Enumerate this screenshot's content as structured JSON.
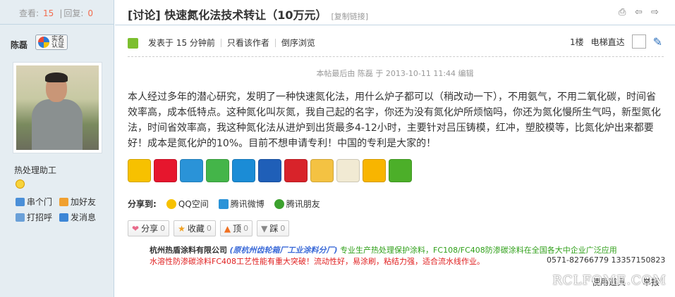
{
  "stats": {
    "views_label": "查看:",
    "views": "15",
    "sep": "|",
    "replies_label": "回复:",
    "replies": "0"
  },
  "author": {
    "name": "陈磊",
    "verify_label": "实名认证",
    "rank": "热处理助工"
  },
  "author_links": {
    "pm_short": "串个门",
    "add_friend": "加好友",
    "greet": "打招呼",
    "message": "发消息"
  },
  "thread": {
    "category": "[讨论]",
    "title": "快速氮化法技术转让（10万元）",
    "copy_link": "[复制链接]"
  },
  "meta": {
    "posted": "发表于 15 分钟前",
    "only_author": "只看该作者",
    "reverse": "倒序浏览",
    "floor": "1楼",
    "elevator": "电梯直达"
  },
  "edited": "本帖最后由 陈磊 于 2013-10-11 11:44 编辑",
  "content": "本人经过多年的潜心研究，发明了一种快速氮化法，用什么炉子都可以（稍改动一下），不用氨气，不用二氧化碳，时间省效率高，成本低特点。这种氮化叫灰氮，我自己起的名字，你还为没有氮化炉所烦恼吗，你还为氮化慢所生气吗，新型氮化法，时间省效率高，我这种氮化法从进炉到出货最多4-12小时，主要针对吕压铸模，红冲，塑胶模等，比氮化炉出来都要好！成本是氮化炉的10%。目前不想申请专利！中国的专利是大家的！",
  "share_icons": [
    "qzone-icon",
    "weibo-icon",
    "tencent-weibo-icon",
    "wechat-icon",
    "qq-icon",
    "renren-icon",
    "kaixin-icon",
    "mail-icon",
    "clipboard-icon",
    "favorite-icon",
    "more-icon"
  ],
  "share_to": {
    "label": "分享到:",
    "qzone": "QQ空间",
    "tweibo": "腾讯微博",
    "pengyou": "腾讯朋友"
  },
  "actions": [
    {
      "label": "分享",
      "count": "0"
    },
    {
      "label": "收藏",
      "count": "0"
    },
    {
      "label": "顶",
      "count": "0"
    },
    {
      "label": "踩",
      "count": "0"
    }
  ],
  "ad": {
    "company": "杭州热盾涂料有限公司",
    "factory": "(原杭州齿轮箱厂工业涂料分厂)",
    "line1_tail": "专业生产热处理保护涂料，FC108/FC408防渗碳涂料在全国各大中企业广泛应用",
    "line2": "水溶性防渗碳涂料FC408工艺性能有重大突破！流动性好，易涂刷，粘结力强，适合流水线作业。",
    "phone": "0571-82766779 13357150823"
  },
  "footer": {
    "use_tool": "使用道具",
    "report": "举报"
  },
  "watermark": "RCLFOME.COM"
}
